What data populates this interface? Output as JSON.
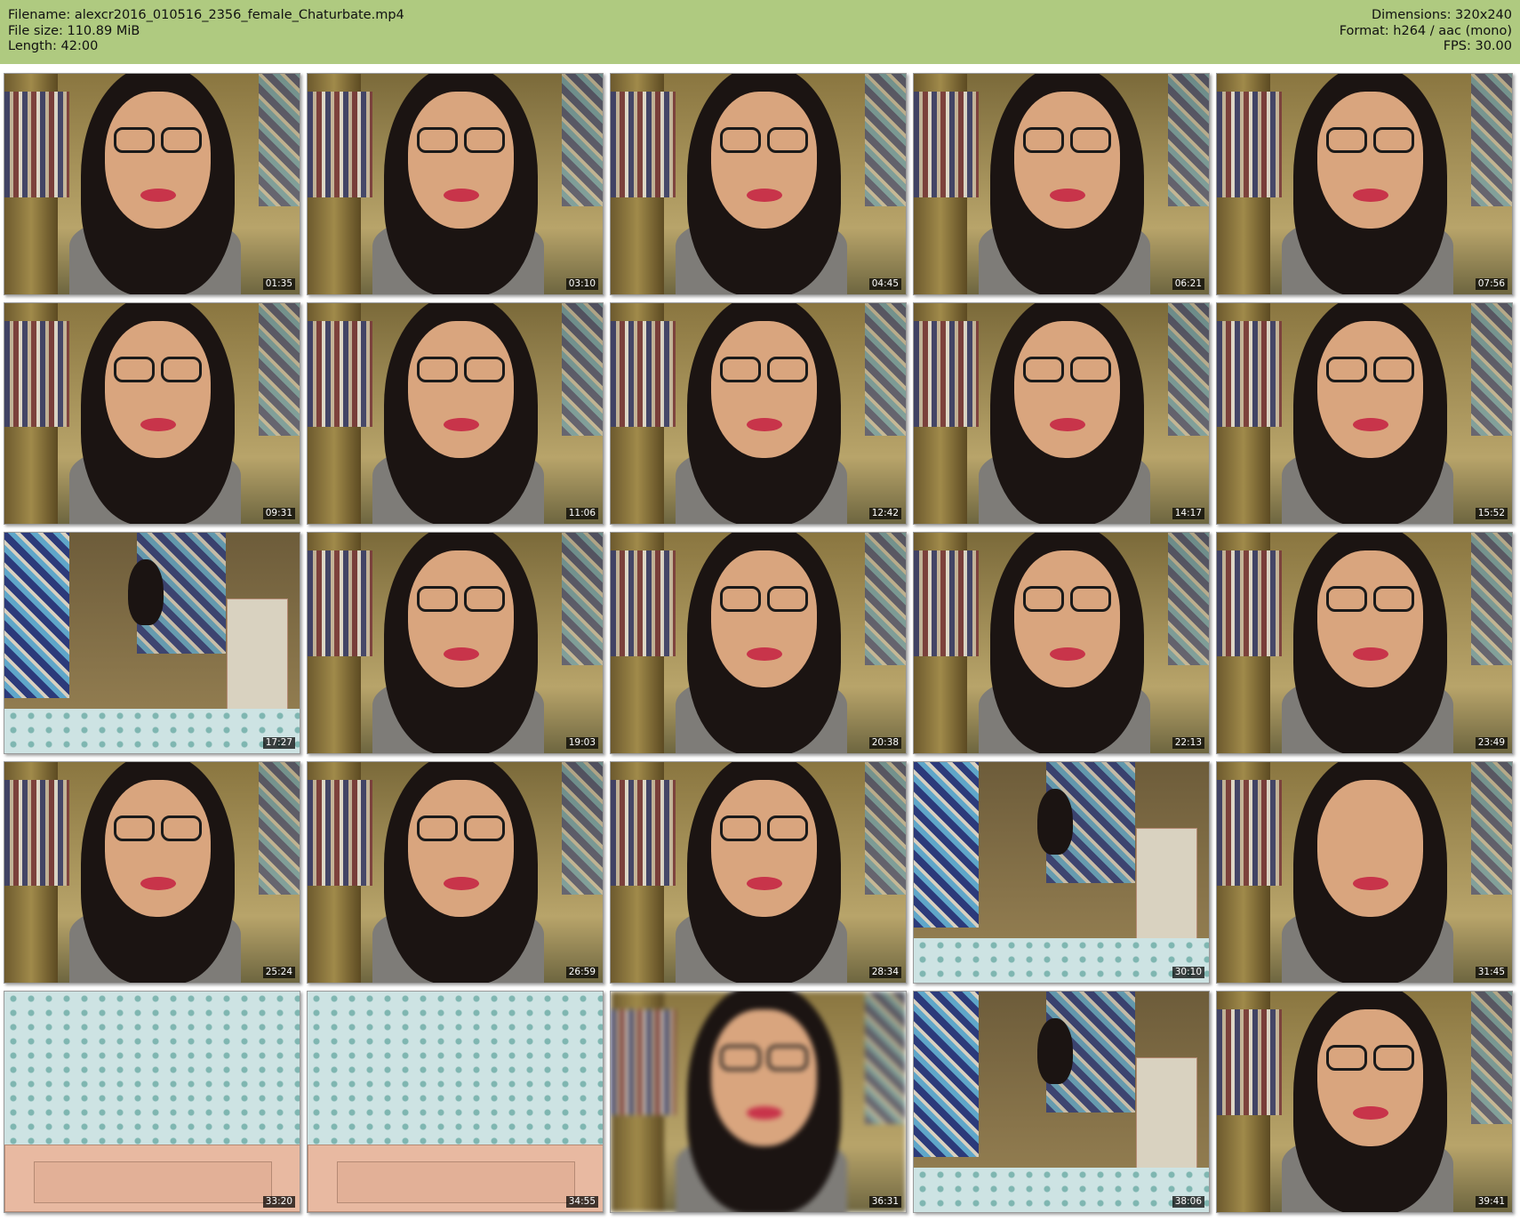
{
  "header": {
    "filename": "Filename: alexcr2016_010516_2356_female_Chaturbate.mp4",
    "filesize": "File size: 110.89 MiB",
    "length": "Length: 42:00",
    "dimensions": "Dimensions: 320x240",
    "format": "Format: h264 / aac (mono)",
    "fps": "FPS: 30.00"
  },
  "thumbnails": [
    {
      "time": "01:35",
      "scene": "face"
    },
    {
      "time": "03:10",
      "scene": "face"
    },
    {
      "time": "04:45",
      "scene": "face"
    },
    {
      "time": "06:21",
      "scene": "face"
    },
    {
      "time": "07:56",
      "scene": "face"
    },
    {
      "time": "09:31",
      "scene": "face"
    },
    {
      "time": "11:06",
      "scene": "face"
    },
    {
      "time": "12:42",
      "scene": "face"
    },
    {
      "time": "14:17",
      "scene": "face"
    },
    {
      "time": "15:52",
      "scene": "face"
    },
    {
      "time": "17:27",
      "scene": "room"
    },
    {
      "time": "19:03",
      "scene": "face"
    },
    {
      "time": "20:38",
      "scene": "face"
    },
    {
      "time": "22:13",
      "scene": "face"
    },
    {
      "time": "23:49",
      "scene": "face"
    },
    {
      "time": "25:24",
      "scene": "face"
    },
    {
      "time": "26:59",
      "scene": "face"
    },
    {
      "time": "28:34",
      "scene": "face"
    },
    {
      "time": "30:10",
      "scene": "room"
    },
    {
      "time": "31:45",
      "scene": "closeup"
    },
    {
      "time": "33:20",
      "scene": "bed"
    },
    {
      "time": "34:55",
      "scene": "bed"
    },
    {
      "time": "36:31",
      "scene": "blur"
    },
    {
      "time": "38:06",
      "scene": "room"
    },
    {
      "time": "39:41",
      "scene": "face"
    }
  ]
}
